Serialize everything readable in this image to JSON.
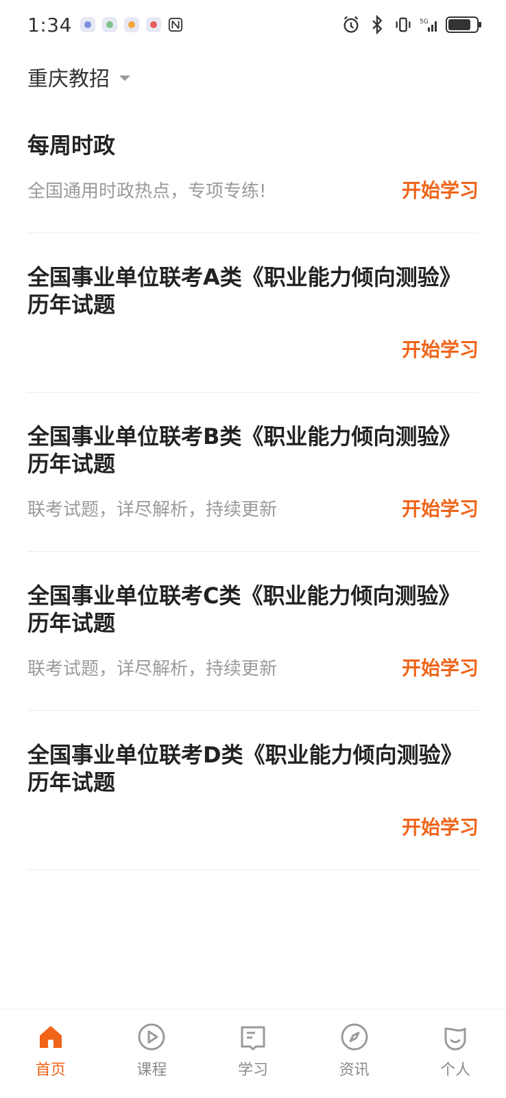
{
  "status_bar": {
    "time": "1:34",
    "network": "5G"
  },
  "header": {
    "region_label": "重庆教招"
  },
  "list": [
    {
      "title": "每周时政",
      "subtitle": "全国通用时政热点，专项专练!",
      "action_label": "开始学习"
    },
    {
      "title": "全国事业单位联考A类《职业能力倾向测验》历年试题",
      "subtitle": "",
      "action_label": "开始学习"
    },
    {
      "title": "全国事业单位联考B类《职业能力倾向测验》历年试题",
      "subtitle": "联考试题，详尽解析，持续更新",
      "action_label": "开始学习"
    },
    {
      "title": "全国事业单位联考C类《职业能力倾向测验》历年试题",
      "subtitle": "联考试题，详尽解析，持续更新",
      "action_label": "开始学习"
    },
    {
      "title": "全国事业单位联考D类《职业能力倾向测验》历年试题",
      "subtitle": "",
      "action_label": "开始学习"
    }
  ],
  "bottom_nav": {
    "items": [
      {
        "label": "首页",
        "icon": "home-icon",
        "active": true
      },
      {
        "label": "课程",
        "icon": "play-icon",
        "active": false
      },
      {
        "label": "学习",
        "icon": "book-icon",
        "active": false
      },
      {
        "label": "资讯",
        "icon": "compass-icon",
        "active": false
      },
      {
        "label": "个人",
        "icon": "profile-icon",
        "active": false
      }
    ]
  },
  "colors": {
    "accent": "#f06419",
    "muted_text": "#9a9a9a",
    "divider": "#ececec"
  }
}
